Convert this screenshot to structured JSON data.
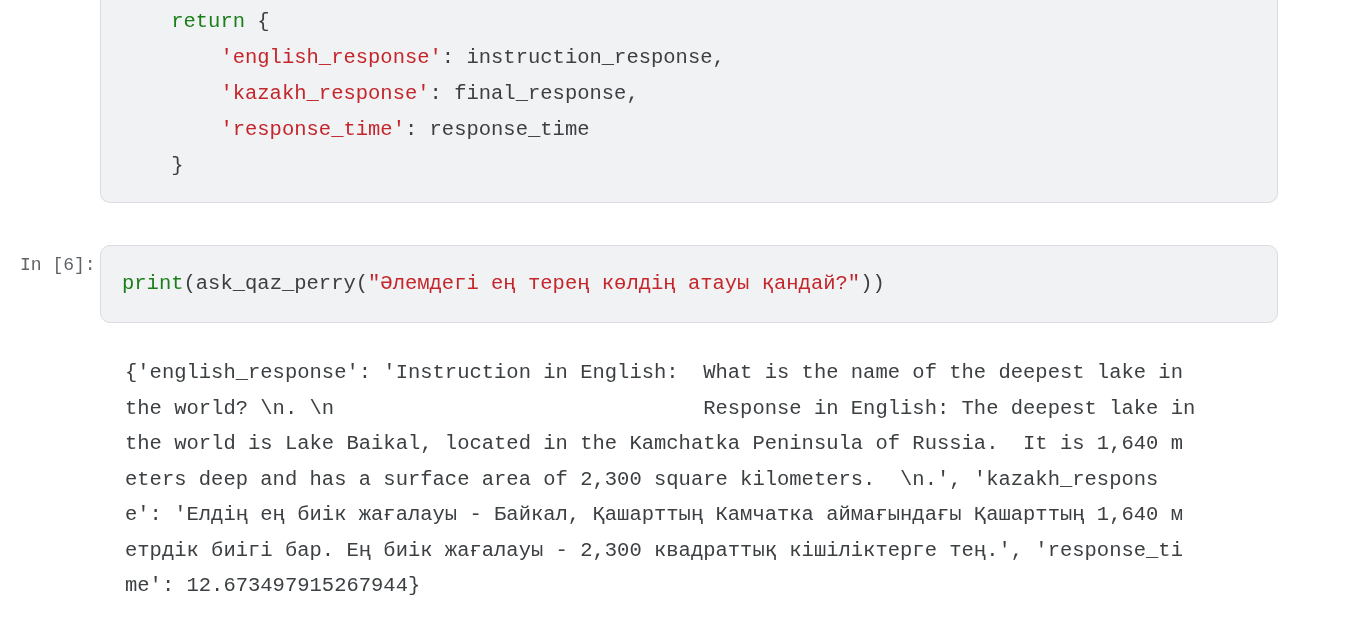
{
  "cells": [
    {
      "code": [
        [
          {
            "kind": "keyword",
            "text": "    return"
          },
          {
            "kind": "plain",
            "text": " {"
          }
        ],
        [
          {
            "kind": "string",
            "text": "        'english_response'"
          },
          {
            "kind": "plain",
            "text": ": instruction_response,"
          }
        ],
        [
          {
            "kind": "string",
            "text": "        'kazakh_response'"
          },
          {
            "kind": "plain",
            "text": ": final_response,"
          }
        ],
        [
          {
            "kind": "string",
            "text": "        'response_time'"
          },
          {
            "kind": "plain",
            "text": ": response_time"
          }
        ],
        [
          {
            "kind": "plain",
            "text": "    }"
          }
        ]
      ]
    },
    {
      "prompt": "In [6]:",
      "code": [
        [
          {
            "kind": "keyword",
            "text": "print"
          },
          {
            "kind": "plain",
            "text": "(ask_qaz_perry("
          },
          {
            "kind": "string",
            "text": "\"Әлемдегі ең терең көлдің атауы қандай?\""
          },
          {
            "kind": "plain",
            "text": "))"
          }
        ]
      ],
      "output": [
        "{'english_response': 'Instruction in English:  What is the name of the deepest lake in",
        "the world? \\n. \\n                              Response in English: The deepest lake in",
        "the world is Lake Baikal, located in the Kamchatka Peninsula of Russia.  It is 1,640 m",
        "eters deep and has a surface area of 2,300 square kilometers.  \\n.', 'kazakh_respons",
        "e': 'Елдің ең биік жағалауы - Байкал, Қашарттың Камчатка аймағындағы Қашарттың 1,640 м",
        "етрдік биігі бар. Ең биік жағалауы - 2,300 квадраттық кішіліктерге тең.', 'response_ti",
        "me': 12.673497915267944}"
      ]
    }
  ]
}
